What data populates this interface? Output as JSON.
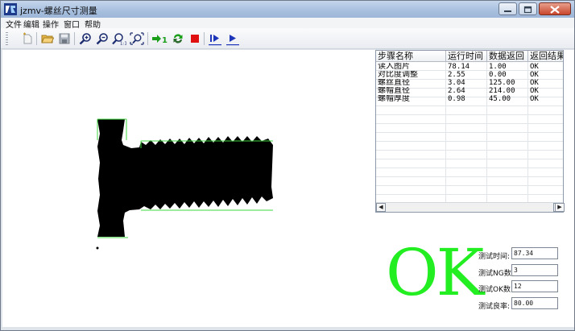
{
  "window": {
    "title": "jzmv-螺丝尺寸测量"
  },
  "menu": {
    "items": [
      "文件",
      "编辑",
      "操作",
      "窗口",
      "帮助"
    ]
  },
  "toolbar": {
    "buttons": [
      {
        "name": "new-document-icon"
      },
      {
        "name": "open-folder-icon"
      },
      {
        "name": "save-disk-icon"
      },
      {
        "name": "zoom-in-icon"
      },
      {
        "name": "zoom-out-icon"
      },
      {
        "name": "zoom-actual-icon",
        "glyph": "1:1"
      },
      {
        "name": "zoom-fit-icon"
      },
      {
        "name": "step-one-icon",
        "label": "1"
      },
      {
        "name": "loop-run-icon"
      },
      {
        "name": "stop-icon"
      },
      {
        "name": "step-run-icon"
      },
      {
        "name": "run-icon"
      }
    ],
    "colors": {
      "green": "#1a9e1a",
      "red": "#e01010",
      "blue": "#1d35b8"
    }
  },
  "results_table": {
    "columns": [
      "步骤名称",
      "运行时间",
      "数据返回",
      "返回结果"
    ],
    "rows": [
      [
        "读入图片",
        "78.14",
        "1.00",
        "OK"
      ],
      [
        "对比度调整",
        "2.55",
        "0.00",
        "OK"
      ],
      [
        "螺丝直径",
        "3.04",
        "125.00",
        "OK"
      ],
      [
        "螺帽直径",
        "2.64",
        "214.00",
        "OK"
      ],
      [
        "螺帽厚度",
        "0.98",
        "45.00",
        "OK"
      ]
    ]
  },
  "result": {
    "status": "OK",
    "status_color": "#22ee22"
  },
  "stats": {
    "test_time_label": "测试时间:",
    "test_time": "87.34",
    "ng_count_label": "测试NG数:",
    "ng_count": "3",
    "ok_count_label": "测试OK数:",
    "ok_count": "12",
    "yield_label": "测试良率:",
    "yield": "80.00"
  },
  "canvas": {
    "measure_line_color": "#3ed43e",
    "image": "screw-silhouette"
  }
}
